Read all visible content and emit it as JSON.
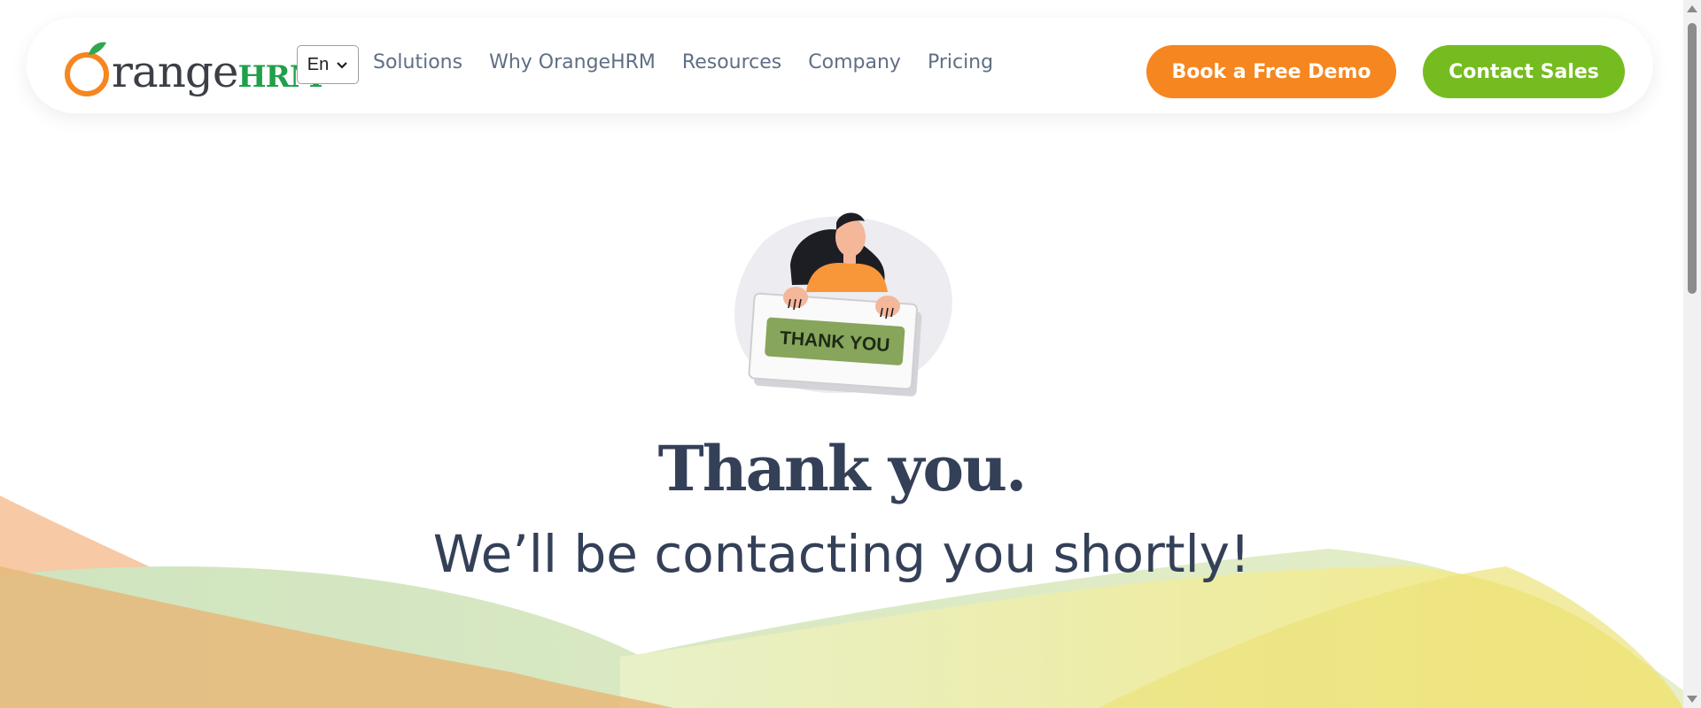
{
  "header": {
    "logo": {
      "text_a": "range",
      "text_b": "HRM",
      "icon": "orange-logo-icon"
    },
    "language": {
      "value": "En",
      "icon": "chevron-down-icon"
    },
    "nav": [
      "Solutions",
      "Why OrangeHRM",
      "Resources",
      "Company",
      "Pricing"
    ],
    "book_demo_label": "Book a Free Demo",
    "contact_sales_label": "Contact Sales"
  },
  "hero": {
    "sign_text": "THANK YOU",
    "title": "Thank you.",
    "subtitle": "We’ll be contacting you shortly!"
  },
  "colors": {
    "brand_orange": "#f6861f",
    "brand_green": "#75bc20",
    "text_dark": "#344058",
    "nav_text": "#5f6f84"
  }
}
